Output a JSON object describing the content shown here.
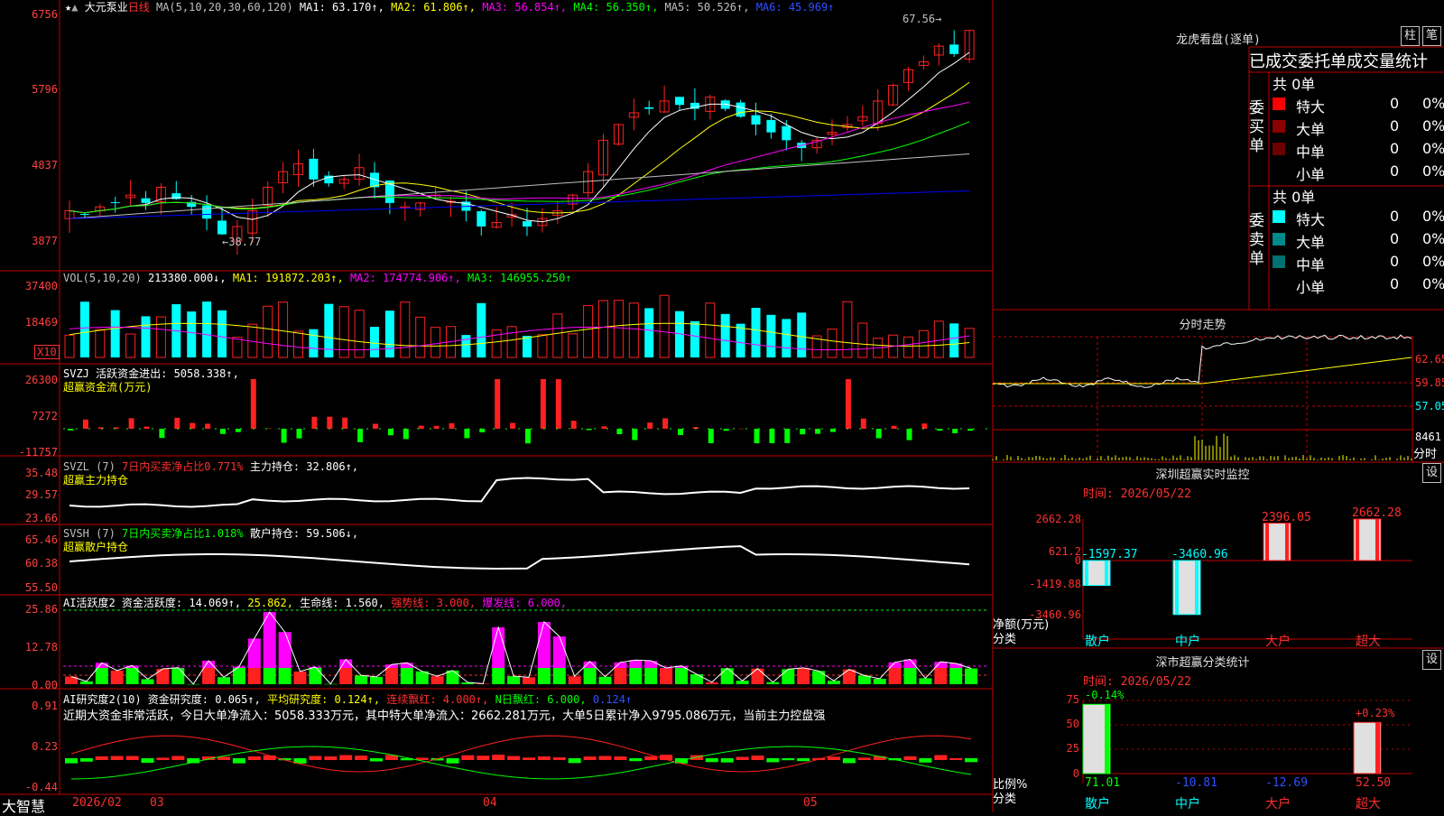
{
  "colors": {
    "up": "#ff2020",
    "down": "#00ffff",
    "frame": "#c00000",
    "ma1": "#ffffff",
    "ma2": "#ffff00",
    "ma3": "#ff00ff",
    "ma4": "#00ff00",
    "ma5": "#c0c0c0",
    "ma6": "#0000ff"
  },
  "main": {
    "stock": "大元泵业",
    "period": "日线",
    "ma_header": "MA(5,10,20,30,60,120)",
    "ma": [
      {
        "label": "MA1: 63.170↑,",
        "color": "#ffffff"
      },
      {
        "label": "MA2: 61.806↑,",
        "color": "#ffff00"
      },
      {
        "label": "MA3: 56.854↑,",
        "color": "#ff00ff"
      },
      {
        "label": "MA4: 56.350↑,",
        "color": "#00ff00"
      },
      {
        "label": "MA5: 50.526↑,",
        "color": "#c0c0c0"
      },
      {
        "label": "MA6: 45.969↑",
        "color": "#0000ff"
      }
    ],
    "y_ticks": [
      "6756",
      "5796",
      "4837",
      "3877"
    ],
    "high_label": "67.56",
    "low_label": "38.77"
  },
  "vol": {
    "header": "VOL(5,10,20)",
    "value": "213380.000↓,",
    "ma1": "MA1: 191872.203↑,",
    "ma2": "MA2: 174774.906↑,",
    "ma3": "MA3: 146955.250↑",
    "y_ticks": [
      "37400",
      "18469"
    ],
    "unit": "X10"
  },
  "svzj": {
    "header": "SVZJ  活跃资金进出: 5058.338↑,",
    "sub": "超赢资金流(万元)",
    "y_ticks": [
      "26300",
      "7272",
      "-11757"
    ]
  },
  "svzl": {
    "header": "SVZL (7)",
    "note": "7日内买卖净占比0.771%",
    "value": "主力持仓: 32.806↑,",
    "sub": "超赢主力持仓",
    "y_ticks": [
      "35.48",
      "29.57",
      "23.66"
    ]
  },
  "svsh": {
    "header": "SVSH (7)",
    "note": "7日内买卖净占比1.018%",
    "value": "散户持仓: 59.506↓,",
    "sub": "超赢散户持仓",
    "y_ticks": [
      "65.46",
      "60.38",
      "55.50"
    ]
  },
  "ai1": {
    "header": "AI活跃度2 资金活跃度: 14.069↑,",
    "v2": "25.862,",
    "v3": "生命线: 1.560,",
    "v4": "强势线: 3.000,",
    "v5": "爆发线: 6.000,",
    "y_ticks": [
      "25.86",
      "12.78",
      "0.00"
    ]
  },
  "ai2": {
    "header": "AI研究度2(10) 资金研究度: 0.065↑,",
    "v2": "平均研究度: 0.124↑,",
    "v3": "连续飘红: 4.000↑,",
    "v4": "N日飘红: 6.000,",
    "v5": "0.124↑",
    "comment": "近期大资金非常活跃，今日大单净流入：5058.333万元，其中特大单净流入：2662.281万元，大单5日累计净入9795.086万元，当前主力控盘强",
    "y_ticks": [
      "0.91",
      "0.23",
      "-0.44"
    ]
  },
  "bottom": {
    "logo": "大智慧",
    "dates": [
      "2026/02",
      "03",
      "04",
      "05"
    ]
  },
  "longhu": {
    "title": "龙虎看盘(逐单)",
    "btn1": "柱",
    "btn2": "笔",
    "subtitle": "已成交委托单成交量统计",
    "buy_label": "委买单",
    "sell_label": "委卖单",
    "buy_total": "共 0单",
    "sell_total": "共 0单",
    "rows": [
      {
        "name": "特大",
        "v": "0",
        "p": "0%"
      },
      {
        "name": "大单",
        "v": "0",
        "p": "0%"
      },
      {
        "name": "中单",
        "v": "0",
        "p": "0%"
      },
      {
        "name": "小单",
        "v": "0",
        "p": "0%"
      }
    ]
  },
  "fenshi": {
    "title": "分时走势",
    "y_ticks": [
      "62.65",
      "59.85",
      "57.05",
      "8461"
    ],
    "unit": "分时"
  },
  "szmon": {
    "title": "深圳超赢实时监控",
    "btn": "设",
    "date": "时间: 2026/05/22",
    "y_ticks": [
      "2662.28",
      "621.2",
      "0",
      "-1419.88",
      "-3460.96"
    ],
    "ylabel": "净额(万元)",
    "xlabel": "分类",
    "bars": [
      {
        "label": "散户",
        "value": -1597.37,
        "vlabel": "-1597.37"
      },
      {
        "label": "中户",
        "value": -3460.96,
        "vlabel": "-3460.96"
      },
      {
        "label": "大户",
        "value": 2396.05,
        "vlabel": "2396.05"
      },
      {
        "label": "超大",
        "value": 2662.28,
        "vlabel": "2662.28"
      }
    ]
  },
  "szcls": {
    "title": "深市超赢分类统计",
    "btn": "设",
    "date": "时间: 2026/05/22",
    "y_ticks": [
      "75",
      "50",
      "25",
      "0"
    ],
    "ylabel": "比例%",
    "xlabel": "分类",
    "bars": [
      {
        "label": "散户",
        "value": 71.01,
        "vlabel": "71.01",
        "delta": "-0.14%"
      },
      {
        "label": "中户",
        "value": -10.81,
        "vlabel": "-10.81",
        "delta": ""
      },
      {
        "label": "大户",
        "value": -12.69,
        "vlabel": "-12.69",
        "delta": ""
      },
      {
        "label": "超大",
        "value": 52.5,
        "vlabel": "52.50",
        "delta": "+0.23%"
      }
    ]
  }
}
